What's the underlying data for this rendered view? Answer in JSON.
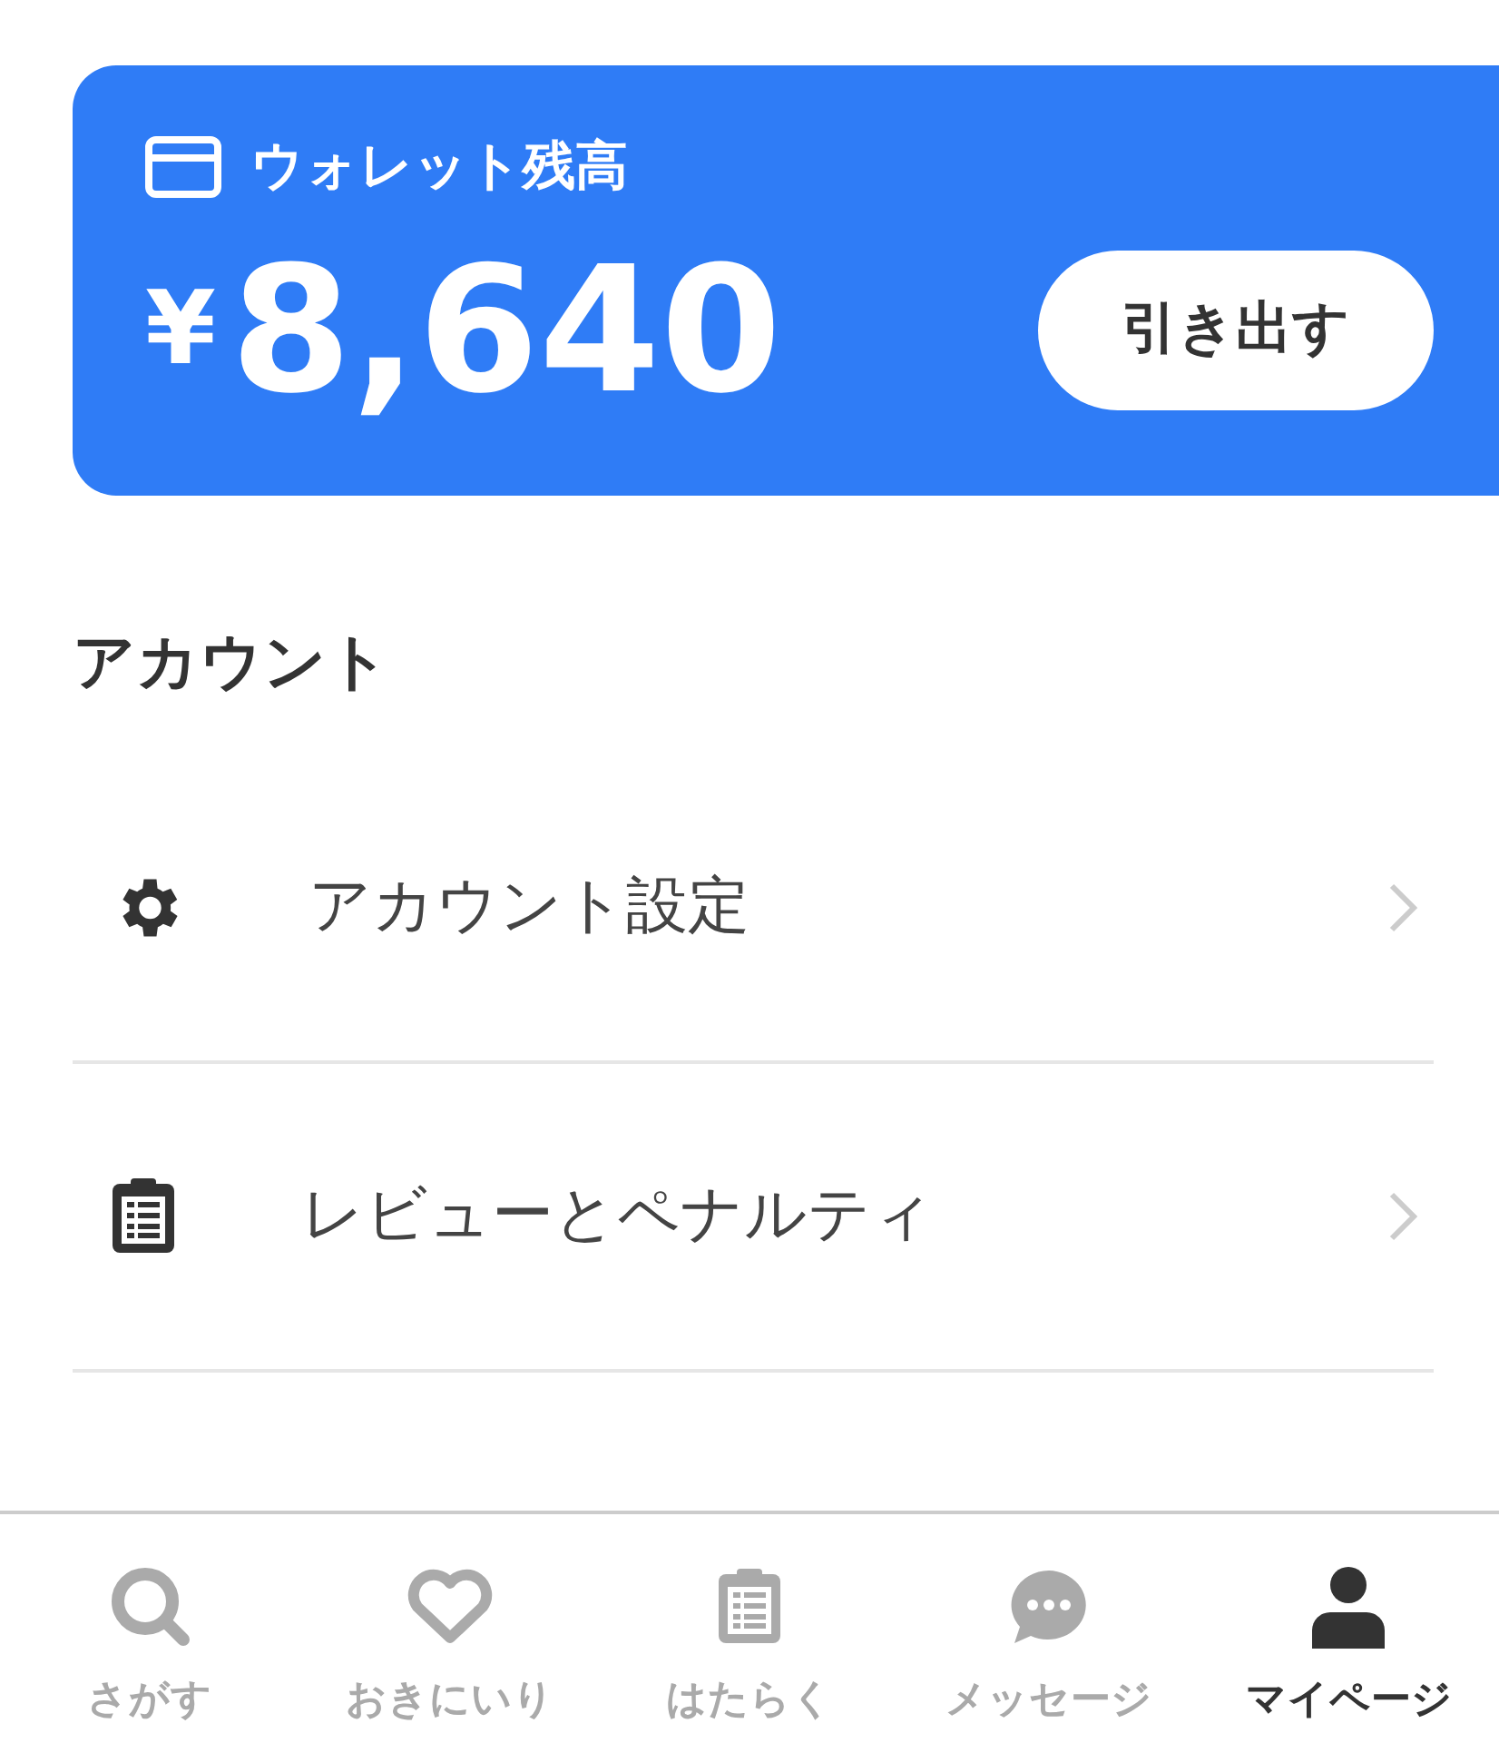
{
  "wallet": {
    "title": "ウォレット残高",
    "currency": "¥",
    "amount": "8,640",
    "button": "引き出す"
  },
  "section": {
    "title": "アカウント"
  },
  "menu": [
    {
      "label": "アカウント設定"
    },
    {
      "label": "レビューとペナルティ"
    }
  ],
  "tabs": [
    {
      "label": "さがす",
      "selected": false
    },
    {
      "label": "おきにいり",
      "selected": false
    },
    {
      "label": "はたらく",
      "selected": false
    },
    {
      "label": "メッセージ",
      "selected": false
    },
    {
      "label": "マイページ",
      "selected": true
    }
  ]
}
